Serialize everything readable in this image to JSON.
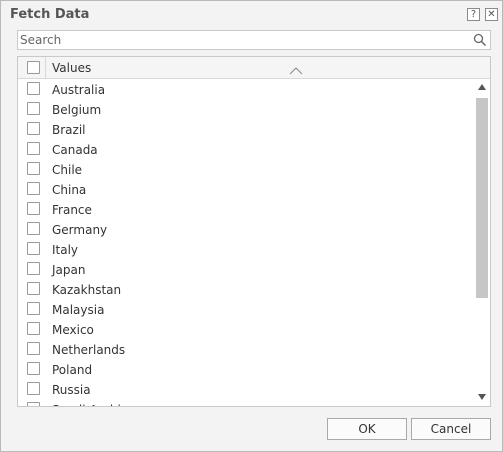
{
  "dialog": {
    "title": "Fetch Data",
    "help_icon": "help-icon",
    "close_icon": "close-icon"
  },
  "search": {
    "placeholder": "Search",
    "value": "",
    "icon": "search-icon"
  },
  "list": {
    "header": "Values",
    "sort_icon": "sort-ascending-icon",
    "items": [
      {
        "label": "Australia",
        "checked": false
      },
      {
        "label": "Belgium",
        "checked": false
      },
      {
        "label": "Brazil",
        "checked": false
      },
      {
        "label": "Canada",
        "checked": false
      },
      {
        "label": "Chile",
        "checked": false
      },
      {
        "label": "China",
        "checked": false
      },
      {
        "label": "France",
        "checked": false
      },
      {
        "label": "Germany",
        "checked": false
      },
      {
        "label": "Italy",
        "checked": false
      },
      {
        "label": "Japan",
        "checked": false
      },
      {
        "label": "Kazakhstan",
        "checked": false
      },
      {
        "label": "Malaysia",
        "checked": false
      },
      {
        "label": "Mexico",
        "checked": false
      },
      {
        "label": "Netherlands",
        "checked": false
      },
      {
        "label": "Poland",
        "checked": false
      },
      {
        "label": "Russia",
        "checked": false
      },
      {
        "label": "Saudi Arabia",
        "checked": false
      }
    ]
  },
  "buttons": {
    "ok": "OK",
    "cancel": "Cancel"
  }
}
